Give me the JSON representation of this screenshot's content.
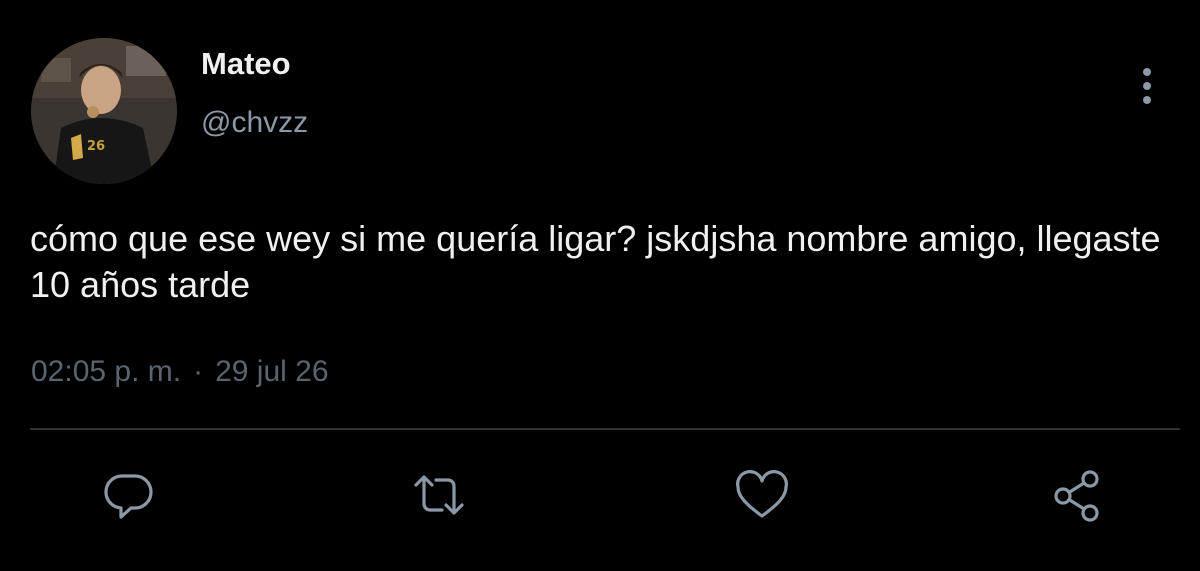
{
  "tweet": {
    "author": {
      "display_name": "Mateo",
      "handle": "@chvzz",
      "avatar": {
        "description_icon": "profile-photo-icon",
        "jersey_number": "26"
      }
    },
    "text": "cómo que ese wey si me quería ligar? jskdjsha nombre amigo, llegaste 10 años tarde",
    "time": "02:05 p. m.",
    "separator": "·",
    "date": "29 jul 26"
  },
  "actions": [
    {
      "name": "reply",
      "icon": "reply-icon"
    },
    {
      "name": "retweet",
      "icon": "retweet-icon"
    },
    {
      "name": "like",
      "icon": "heart-icon"
    },
    {
      "name": "share",
      "icon": "share-icon"
    }
  ],
  "colors": {
    "background": "#000000",
    "primary_text": "#f0f0f0",
    "secondary_text": "#8b98a5",
    "muted_text": "#59646e",
    "divider": "#2f3336",
    "icon": "#8b98a5"
  }
}
